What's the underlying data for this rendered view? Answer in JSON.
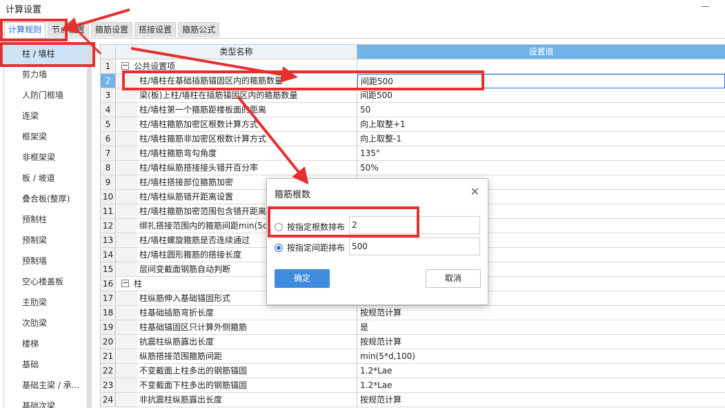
{
  "window": {
    "title": "计算设置",
    "minimize": "—"
  },
  "tabs": [
    "计算规则",
    "节点设置",
    "箍筋设置",
    "搭接设置",
    "箍筋公式"
  ],
  "sidebar": [
    "柱 / 墙柱",
    "剪力墙",
    "人防门框墙",
    "连梁",
    "框架梁",
    "非框架梁",
    "板 / 坡道",
    "叠合板(整厚)",
    "预制柱",
    "预制梁",
    "预制墙",
    "空心楼盖板",
    "主肋梁",
    "次肋梁",
    "楼梯",
    "基础",
    "基础主梁 / 承...",
    "基础次梁"
  ],
  "grid": {
    "col_name": "类型名称",
    "col_value": "设置值",
    "rows": [
      {
        "n": "1",
        "name": "公共设置项",
        "value": "",
        "group": true,
        "toggle": "−"
      },
      {
        "n": "2",
        "name": "柱/墙柱在基础插筋锚固区内的箍筋数量",
        "value": "间距500",
        "selected": true
      },
      {
        "n": "3",
        "name": "梁(板)上柱/墙柱在插筋锚固区内的箍筋数量",
        "value": "间距500"
      },
      {
        "n": "4",
        "name": "柱/墙柱第一个箍筋距楼板面的距离",
        "value": "50"
      },
      {
        "n": "5",
        "name": "柱/墙柱箍筋加密区根数计算方式",
        "value": "向上取整+1"
      },
      {
        "n": "6",
        "name": "柱/墙柱箍筋非加密区根数计算方式",
        "value": "向上取整-1"
      },
      {
        "n": "7",
        "name": "柱/墙柱箍筋弯勾角度",
        "value": "135°"
      },
      {
        "n": "8",
        "name": "柱/墙柱纵筋搭接接头错开百分率",
        "value": "50%"
      },
      {
        "n": "9",
        "name": "柱/墙柱搭接部位箍筋加密",
        "value": ""
      },
      {
        "n": "10",
        "name": "柱/墙柱纵筋错开距离设置",
        "value": ""
      },
      {
        "n": "11",
        "name": "柱/墙柱箍筋加密范围包含错开距离",
        "value": ""
      },
      {
        "n": "12",
        "name": "绑扎搭接范围内的箍筋间距min(5d",
        "value": ""
      },
      {
        "n": "13",
        "name": "柱/墙柱螺旋箍筋是否连续通过",
        "value": ""
      },
      {
        "n": "14",
        "name": "柱/墙柱圆形箍筋的搭接长度",
        "value": ""
      },
      {
        "n": "15",
        "name": "层间变截面钢筋自动判断",
        "value": ""
      },
      {
        "n": "16",
        "name": "柱",
        "value": "",
        "group": true,
        "toggle": "−"
      },
      {
        "n": "17",
        "name": "柱纵筋伸入基础锚固形式",
        "value": ""
      },
      {
        "n": "18",
        "name": "柱基础插筋弯折长度",
        "value": "按规范计算"
      },
      {
        "n": "19",
        "name": "柱基础锚固区只计算外侧箍筋",
        "value": "是"
      },
      {
        "n": "20",
        "name": "抗震柱纵筋露出长度",
        "value": "按规范计算"
      },
      {
        "n": "21",
        "name": "纵筋搭接范围箍筋间距",
        "value": "min(5*d,100)"
      },
      {
        "n": "22",
        "name": "不变截面上柱多出的钢筋锚固",
        "value": "1.2*Lae"
      },
      {
        "n": "23",
        "name": "不变截面下柱多出的钢筋锚固",
        "value": "1.2*Lae"
      },
      {
        "n": "24",
        "name": "非抗震柱纵筋露出长度",
        "value": "按规范计算"
      }
    ]
  },
  "dialog": {
    "title": "箍筋根数",
    "close": "✕",
    "opt1_label": "按指定根数排布",
    "opt1_value": "2",
    "opt2_label": "按指定间距排布",
    "opt2_value": "500",
    "selected": "opt2",
    "ok": "确定",
    "cancel": "取消"
  },
  "colors": {
    "accent": "#3f8bdd",
    "header": "#6fb3e8",
    "annotation": "#e53030"
  }
}
